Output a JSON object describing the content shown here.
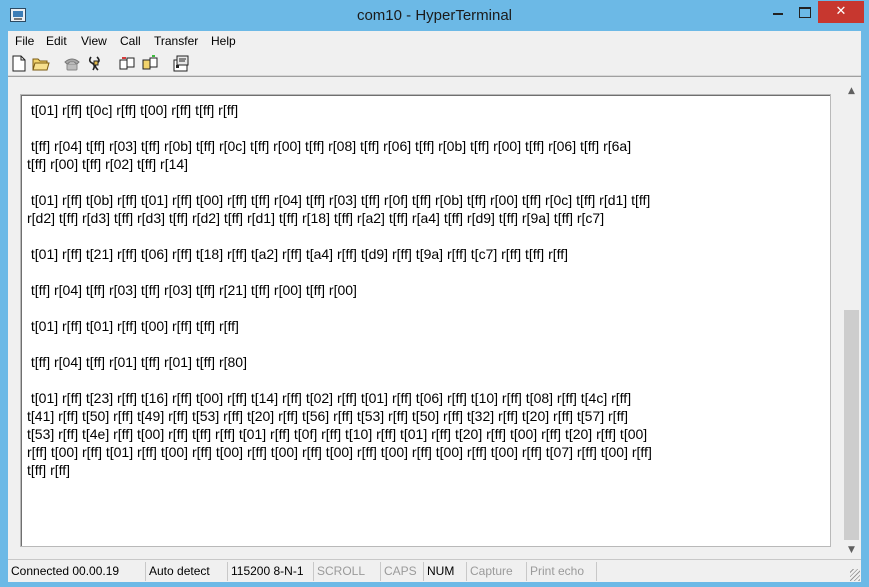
{
  "window": {
    "title": "com10 - HyperTerminal",
    "close_glyph": "✕"
  },
  "menu": [
    "File",
    "Edit",
    "View",
    "Call",
    "Transfer",
    "Help"
  ],
  "toolbar": {
    "buttons": [
      "new-file-icon",
      "open-folder-icon",
      "dial-phone-icon",
      "disconnect-icon",
      "send-file-icon",
      "receive-file-icon",
      "properties-icon"
    ]
  },
  "terminal": {
    "lines": [
      " t[01] r[ff] t[0c] r[ff] t[00] r[ff] t[ff] r[ff]",
      "",
      " t[ff] r[04] t[ff] r[03] t[ff] r[0b] t[ff] r[0c] t[ff] r[00] t[ff] r[08] t[ff] r[06] t[ff] r[0b] t[ff] r[00] t[ff] r[06] t[ff] r[6a]",
      "t[ff] r[00] t[ff] r[02] t[ff] r[14]",
      "",
      " t[01] r[ff] t[0b] r[ff] t[01] r[ff] t[00] r[ff] t[ff] r[04] t[ff] r[03] t[ff] r[0f] t[ff] r[0b] t[ff] r[00] t[ff] r[0c] t[ff] r[d1] t[ff]",
      "r[d2] t[ff] r[d3] t[ff] r[d3] t[ff] r[d2] t[ff] r[d1] t[ff] r[18] t[ff] r[a2] t[ff] r[a4] t[ff] r[d9] t[ff] r[9a] t[ff] r[c7]",
      "",
      " t[01] r[ff] t[21] r[ff] t[06] r[ff] t[18] r[ff] t[a2] r[ff] t[a4] r[ff] t[d9] r[ff] t[9a] r[ff] t[c7] r[ff] t[ff] r[ff]",
      "",
      " t[ff] r[04] t[ff] r[03] t[ff] r[03] t[ff] r[21] t[ff] r[00] t[ff] r[00]",
      "",
      " t[01] r[ff] t[01] r[ff] t[00] r[ff] t[ff] r[ff]",
      "",
      " t[ff] r[04] t[ff] r[01] t[ff] r[01] t[ff] r[80]",
      "",
      " t[01] r[ff] t[23] r[ff] t[16] r[ff] t[00] r[ff] t[14] r[ff] t[02] r[ff] t[01] r[ff] t[06] r[ff] t[10] r[ff] t[08] r[ff] t[4c] r[ff]",
      "t[41] r[ff] t[50] r[ff] t[49] r[ff] t[53] r[ff] t[20] r[ff] t[56] r[ff] t[53] r[ff] t[50] r[ff] t[32] r[ff] t[20] r[ff] t[57] r[ff]",
      "t[53] r[ff] t[4e] r[ff] t[00] r[ff] t[ff] r[ff] t[01] r[ff] t[0f] r[ff] t[10] r[ff] t[01] r[ff] t[20] r[ff] t[00] r[ff] t[20] r[ff] t[00]",
      "r[ff] t[00] r[ff] t[01] r[ff] t[00] r[ff] t[00] r[ff] t[00] r[ff] t[00] r[ff] t[00] r[ff] t[00] r[ff] t[00] r[ff] t[07] r[ff] t[00] r[ff]",
      "t[ff] r[ff]"
    ]
  },
  "scrollbar": {
    "up_glyph": "▲",
    "down_glyph": "▼"
  },
  "status": {
    "connected": "Connected 00.00.19",
    "detect": "Auto detect",
    "port": "115200 8-N-1",
    "scroll": "SCROLL",
    "caps": "CAPS",
    "num": "NUM",
    "capture": "Capture",
    "print_echo": "Print echo"
  }
}
